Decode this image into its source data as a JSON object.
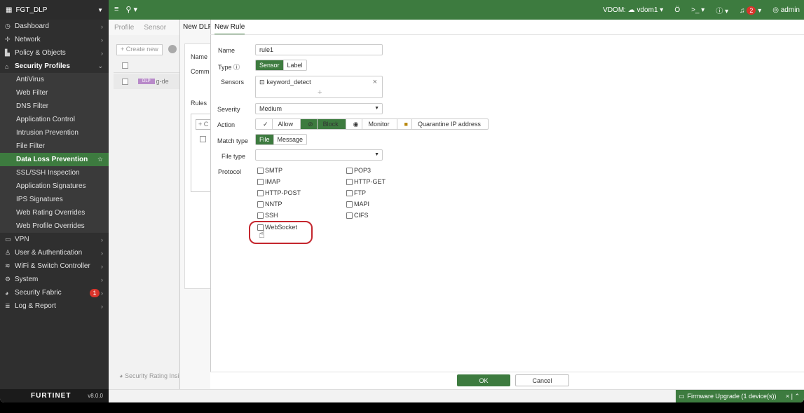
{
  "topbar": {
    "device_name": "FGT_DLP",
    "vdom_label": "VDOM:",
    "vdom_value": "vdom1",
    "notification_count": "2",
    "user": "admin"
  },
  "sidebar": {
    "items": [
      {
        "label": "Dashboard",
        "icon": "dashboard-icon"
      },
      {
        "label": "Network",
        "icon": "network-icon"
      },
      {
        "label": "Policy & Objects",
        "icon": "policy-icon"
      },
      {
        "label": "Security Profiles",
        "icon": "lock-icon"
      },
      {
        "label": "AntiVirus"
      },
      {
        "label": "Web Filter"
      },
      {
        "label": "DNS Filter"
      },
      {
        "label": "Application Control"
      },
      {
        "label": "Intrusion Prevention"
      },
      {
        "label": "File Filter"
      },
      {
        "label": "Data Loss Prevention"
      },
      {
        "label": "SSL/SSH Inspection"
      },
      {
        "label": "Application Signatures"
      },
      {
        "label": "IPS Signatures"
      },
      {
        "label": "Web Rating Overrides"
      },
      {
        "label": "Web Profile Overrides"
      },
      {
        "label": "VPN",
        "icon": "vpn-icon"
      },
      {
        "label": "User & Authentication",
        "icon": "user-icon"
      },
      {
        "label": "WiFi & Switch Controller",
        "icon": "wifi-icon"
      },
      {
        "label": "System",
        "icon": "gear-icon"
      },
      {
        "label": "Security Fabric",
        "icon": "fabric-icon",
        "badge": "1"
      },
      {
        "label": "Log & Report",
        "icon": "log-icon"
      }
    ],
    "logo": "FURTINET",
    "version": "v8.0.0"
  },
  "background": {
    "tab_profile": "Profile",
    "tab_sensor": "Sensor",
    "create_new": "+ Create new",
    "row_name": "g-de",
    "dlp_tag": "DLP",
    "security_rating": "Security Rating Insi"
  },
  "dlp_panel": {
    "title": "New DLP",
    "name_label": "Name",
    "comments_label": "Comm",
    "rules_label": "Rules",
    "add_label": "+ C"
  },
  "rule": {
    "title": "New Rule",
    "name_label": "Name",
    "name_value": "rule1",
    "type_label": "Type",
    "type_options": [
      "Sensor",
      "Label"
    ],
    "sensors_label": "Sensors",
    "sensor_value": "keyword_detect",
    "severity_label": "Severity",
    "severity_value": "Medium",
    "action_label": "Action",
    "action_options": [
      "Allow",
      "Block",
      "Monitor",
      "Quarantine IP address"
    ],
    "match_type_label": "Match type",
    "match_type_options": [
      "File",
      "Message"
    ],
    "file_type_label": "File type",
    "file_type_value": "",
    "protocol_label": "Protocol",
    "protocols_left": [
      "SMTP",
      "IMAP",
      "HTTP-POST",
      "NNTP",
      "SSH",
      "WebSocket"
    ],
    "protocols_right": [
      "POP3",
      "HTTP-GET",
      "FTP",
      "MAPI",
      "CIFS"
    ],
    "ok_label": "OK",
    "cancel_label": "Cancel"
  },
  "status": {
    "firmware_upgrade": "Firmware Upgrade (1 device(s))"
  },
  "colors": {
    "brand_green": "#3d7b3f",
    "sidebar_bg": "#2f2f2f",
    "highlight_red": "#c4262e"
  }
}
